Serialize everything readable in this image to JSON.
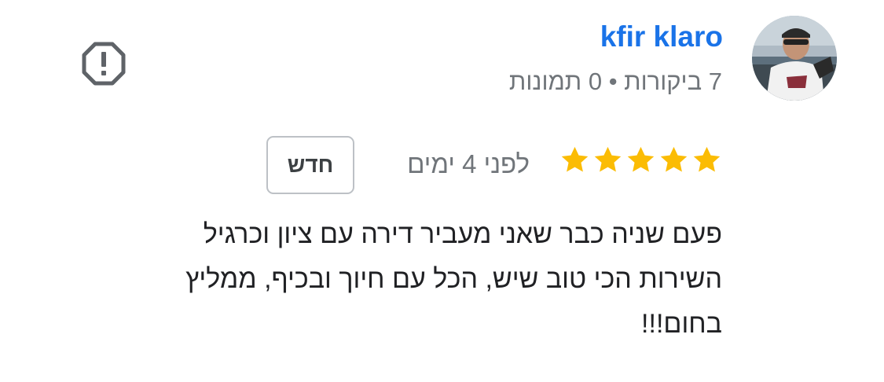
{
  "reviewer": {
    "name": "kfir klaro",
    "meta": "7 ביקורות • 0 תמונות"
  },
  "review": {
    "rating": 5,
    "max_rating": 5,
    "date": "לפני 4 ימים",
    "badge": "חדש",
    "lines": [
      "פעם שניה כבר שאני מעביר דירה עם ציון וכרגיל",
      "השירות הכי טוב שיש, הכל עם חיוך ובכיף, ממליץ",
      "בחום!!!"
    ]
  },
  "icons": {
    "report": "report-octagon-icon",
    "star": "star-icon",
    "avatar": "profile-photo"
  },
  "colors": {
    "name": "#1a73e8",
    "star": "#fbbc04",
    "meta": "#70757a",
    "text": "#202124",
    "badge_border": "#bdc1c6"
  }
}
